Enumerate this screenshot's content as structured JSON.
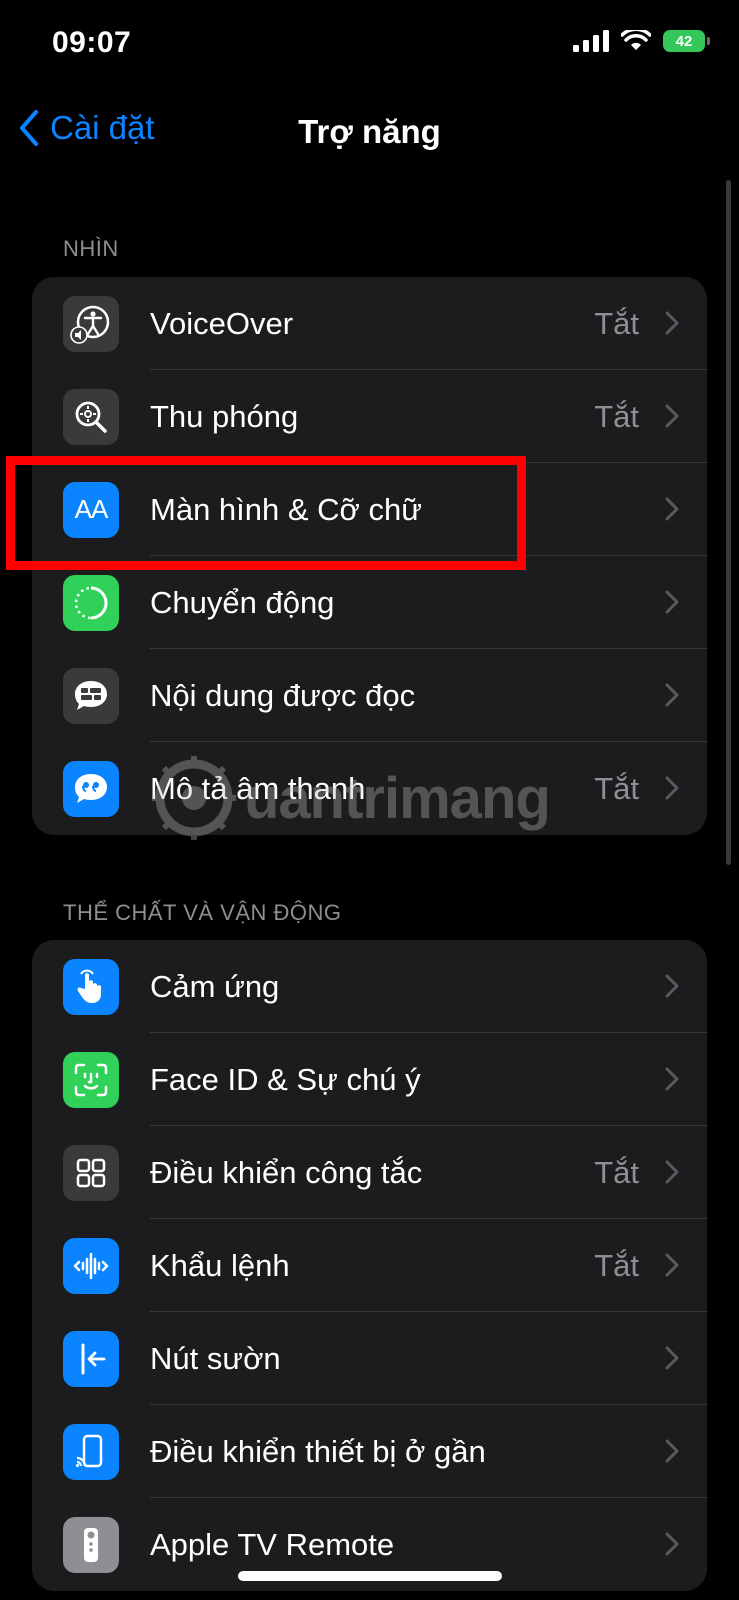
{
  "status_bar": {
    "time": "09:07",
    "battery": "42"
  },
  "nav": {
    "back_label": "Cài đặt",
    "title": "Trợ năng"
  },
  "sections": [
    {
      "header": "NHÌN",
      "items": [
        {
          "label": "VoiceOver",
          "value": "Tắt",
          "icon": "voiceover-icon",
          "icon_color": "#3a3a3c"
        },
        {
          "label": "Thu phóng",
          "value": "Tắt",
          "icon": "zoom-icon",
          "icon_color": "#3a3a3c"
        },
        {
          "label": "Màn hình & Cỡ chữ",
          "value": "",
          "icon": "display-text-size-icon",
          "icon_color": "#0a84ff",
          "icon_text": "AA"
        },
        {
          "label": "Chuyển động",
          "value": "",
          "icon": "motion-icon",
          "icon_color": "#30d158"
        },
        {
          "label": "Nội dung được đọc",
          "value": "",
          "icon": "spoken-content-icon",
          "icon_color": "#3a3a3c"
        },
        {
          "label": "Mô tả âm thanh",
          "value": "Tắt",
          "icon": "audio-descriptions-icon",
          "icon_color": "#0a84ff"
        }
      ]
    },
    {
      "header": "THỂ CHẤT VÀ VẬN ĐỘNG",
      "items": [
        {
          "label": "Cảm ứng",
          "value": "",
          "icon": "touch-icon",
          "icon_color": "#0a84ff"
        },
        {
          "label": "Face ID & Sự chú ý",
          "value": "",
          "icon": "face-id-icon",
          "icon_color": "#30d158"
        },
        {
          "label": "Điều khiển công tắc",
          "value": "Tắt",
          "icon": "switch-control-icon",
          "icon_color": "#3a3a3c"
        },
        {
          "label": "Khẩu lệnh",
          "value": "Tắt",
          "icon": "voice-control-icon",
          "icon_color": "#0a84ff"
        },
        {
          "label": "Nút sườn",
          "value": "",
          "icon": "side-button-icon",
          "icon_color": "#0a84ff"
        },
        {
          "label": "Điều khiển thiết bị ở gần",
          "value": "",
          "icon": "control-nearby-devices-icon",
          "icon_color": "#0a84ff"
        },
        {
          "label": "Apple TV Remote",
          "value": "",
          "icon": "apple-tv-remote-icon",
          "icon_color": "#8e8e93"
        }
      ]
    }
  ],
  "watermark": "uantrimang"
}
